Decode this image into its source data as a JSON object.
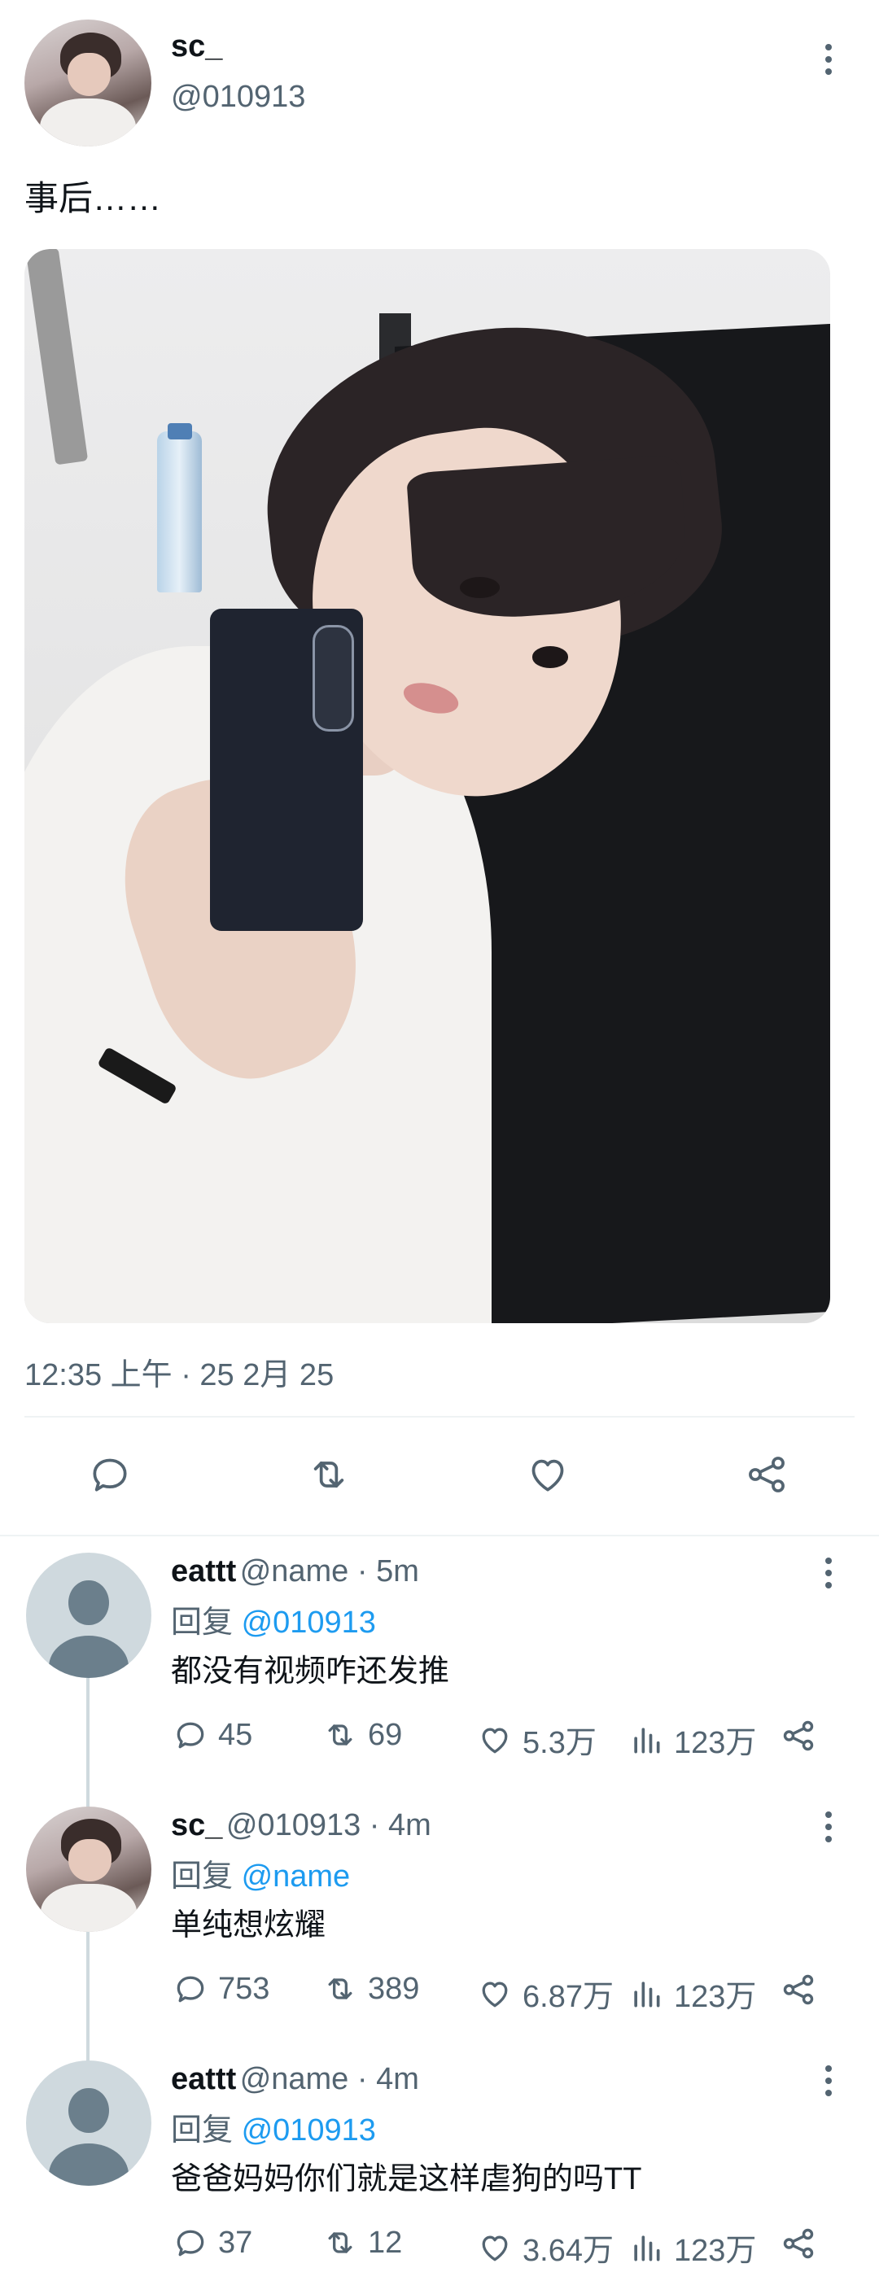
{
  "tweet": {
    "author_name": "sc_",
    "author_handle": "@010913",
    "text": "事后……",
    "timestamp": "12:35 上午 · 25 2月 25"
  },
  "icons": {
    "menu": "more-vertical-icon",
    "reply": "comment-bubble-icon",
    "retweet": "retweet-icon",
    "like": "heart-icon",
    "share": "share-icon",
    "views": "bar-chart-icon"
  },
  "colors": {
    "text": "#0f1419",
    "muted": "#536471",
    "link": "#1d9bf0",
    "divider": "#eff3f4"
  },
  "replies": [
    {
      "name": "eattt",
      "meta": "@name · 5m",
      "reply_prefix": "回复 ",
      "reply_to": "@010913",
      "text": "都没有视频咋还发推",
      "comments": "45",
      "retweets": "69",
      "likes": "5.3万",
      "views": "123万"
    },
    {
      "name": "sc_",
      "meta": "@010913 · 4m",
      "reply_prefix": "回复 ",
      "reply_to": "@name",
      "text": "单纯想炫耀",
      "comments": "753",
      "retweets": "389",
      "likes": "6.87万",
      "views": "123万"
    },
    {
      "name": "eattt",
      "meta": "@name · 4m",
      "reply_prefix": "回复 ",
      "reply_to": "@010913",
      "text": "爸爸妈妈你们就是这样虐狗的吗TT",
      "comments": "37",
      "retweets": "12",
      "likes": "3.64万",
      "views": "123万"
    }
  ]
}
